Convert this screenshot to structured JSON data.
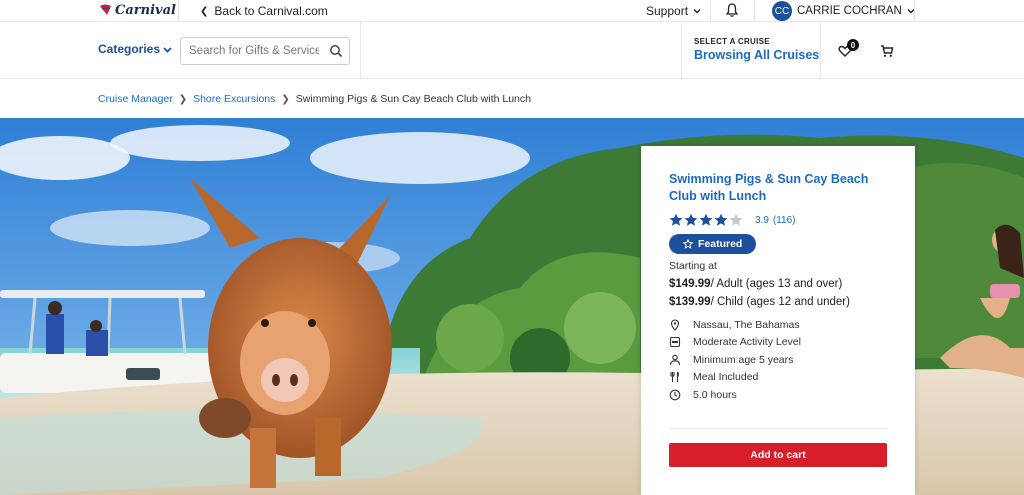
{
  "topbar": {
    "logo_text": "Carnival",
    "back_link": "Back to Carnival.com",
    "support": "Support",
    "user_initials": "CC",
    "user_name": "CARRIE COCHRAN"
  },
  "header": {
    "categories_label": "Categories",
    "search_placeholder": "Search for Gifts & Services",
    "select_cruise_label": "SELECT A CRUISE",
    "browsing_label": "Browsing All Cruises",
    "wishlist_count": "0"
  },
  "breadcrumb": {
    "items": [
      "Cruise Manager",
      "Shore Excursions",
      "Swimming Pigs & Sun Cay Beach Club with Lunch"
    ]
  },
  "product": {
    "title": "Swimming Pigs & Sun Cay Beach Club with Lunch",
    "rating": "3.9",
    "rating_count": "(116)",
    "rating_stars": 3.9,
    "featured_label": "Featured",
    "starting_at": "Starting at",
    "adult_price": "$149.99",
    "adult_desc": "/ Adult (ages 13 and over)",
    "child_price": "$139.99",
    "child_desc": "/ Child (ages 12 and under)",
    "details": [
      {
        "icon": "location-pin-icon",
        "text": "Nassau, The Bahamas"
      },
      {
        "icon": "activity-level-icon",
        "text": "Moderate Activity Level"
      },
      {
        "icon": "person-icon",
        "text": "Minimum age 5 years"
      },
      {
        "icon": "utensils-icon",
        "text": "Meal Included"
      },
      {
        "icon": "clock-icon",
        "text": "5.0 hours"
      }
    ],
    "add_to_cart": "Add to cart"
  },
  "colors": {
    "brand_blue": "#1c4f9c",
    "link_blue": "#1c6bc2",
    "cta_red": "#d81e2c"
  }
}
